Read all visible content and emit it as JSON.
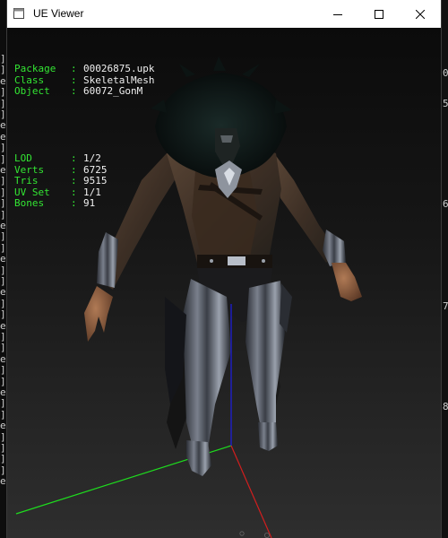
{
  "window": {
    "title": "UE Viewer",
    "controls": {
      "minimize": "minimize",
      "maximize": "maximize",
      "close": "close"
    }
  },
  "info": {
    "object_info": [
      {
        "label": "Package",
        "value": "00026875.upk"
      },
      {
        "label": "Class",
        "value": "SkeletalMesh"
      },
      {
        "label": "Object",
        "value": "60072_GonM"
      }
    ],
    "mesh_stats": [
      {
        "label": "LOD",
        "value": "1/2"
      },
      {
        "label": "Verts",
        "value": "6725"
      },
      {
        "label": "Tris",
        "value": "9515"
      },
      {
        "label": "UV Set",
        "value": "1/1"
      },
      {
        "label": "Bones",
        "value": "91"
      }
    ],
    "separator": ":"
  },
  "axes": {
    "x_color": "#d21e1e",
    "y_color": "#1edc1e",
    "z_color": "#1e1ee6"
  },
  "colors": {
    "label_green": "#33e533",
    "value_white": "#f0f0f0",
    "titlebar": "#ffffff"
  },
  "background": {
    "left_glyphs": [
      "]",
      "]",
      "e",
      "]",
      "]",
      "]",
      "e",
      "e",
      "]",
      "]",
      "e",
      "]",
      "]",
      "]",
      "]",
      "e",
      "]",
      "]",
      "e",
      "]",
      "]",
      "e",
      "]",
      "]",
      "e",
      "]",
      "]",
      "e",
      "]",
      "]",
      "e",
      "]",
      "]",
      "e",
      "]",
      "]",
      "]",
      "]",
      "e"
    ],
    "right_glyphs": [
      "0",
      "5",
      "6",
      "7",
      "8"
    ]
  }
}
